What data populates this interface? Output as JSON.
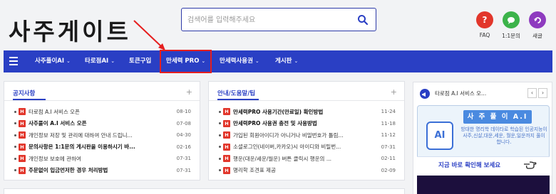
{
  "logo": "사주게이트",
  "search": {
    "placeholder": "검색어를 입력해주세요"
  },
  "quick": [
    {
      "label": "FAQ",
      "glyph": "?",
      "color": "#e2362b"
    },
    {
      "label": "1:1문의",
      "glyph": "●",
      "color": "#3cb34a"
    },
    {
      "label": "새글",
      "glyph": "ᄋ",
      "color": "#8e3bbf"
    }
  ],
  "nav": {
    "items": [
      {
        "label": "사주풀이AI",
        "chevron": "⌄"
      },
      {
        "label": "타로점AI",
        "chevron": "⌄"
      },
      {
        "label": "토큰구입",
        "chevron": ""
      },
      {
        "label": "만세력 PRO",
        "chevron": "⌄"
      },
      {
        "label": "만세력사용권",
        "chevron": "⌄"
      },
      {
        "label": "게시판",
        "chevron": "⌄"
      }
    ]
  },
  "notice": {
    "title": "공지사항",
    "plus": "+",
    "rows": [
      {
        "badge": "H",
        "text": "타로점 A.I 서비스 오픈",
        "date": "08-10",
        "bold": false
      },
      {
        "badge": "H",
        "text": "사주풀이 A.I 서비스 오픈",
        "date": "07-08",
        "bold": true
      },
      {
        "badge": "H",
        "text": "개인정보 저장 및 관리에 대하여 안내 드립니...",
        "date": "04-30",
        "bold": false
      },
      {
        "badge": "H",
        "text": "문의사항은 1:1문의 게시판을 이용하시기 바...",
        "date": "02-16",
        "bold": true
      },
      {
        "badge": "H",
        "text": "개인정보 보호에 관하여",
        "date": "07-31",
        "bold": false
      },
      {
        "badge": "H",
        "text": "주문없이 입금먼저한 경우 처리방법",
        "date": "07-31",
        "bold": true
      }
    ]
  },
  "guide": {
    "title": "안내/도움말/팁",
    "plus": "+",
    "rows": [
      {
        "badge": "H",
        "text": "만세력PRO 사용기간(만료일) 확인방법",
        "date": "11-24",
        "bold": true
      },
      {
        "badge": "H",
        "text": "만세력PRO 사용권 충전 및 사용방법",
        "date": "11-18",
        "bold": true
      },
      {
        "badge": "H",
        "text": "가입된 회원아이디가 아니거나 비밀번호가 틀림...",
        "date": "11-12",
        "bold": false
      },
      {
        "badge": "H",
        "text": "소셜로그인(네이버,카카오)시 아이디와 비밀번...",
        "date": "07-31",
        "bold": false
      },
      {
        "badge": "H",
        "text": "행운(대운/세운/월운) 버튼 클릭시 행운의 ...",
        "date": "02-11",
        "bold": false
      },
      {
        "badge": "H",
        "text": "명리학 조견표 제공",
        "date": "02-09",
        "bold": false
      }
    ]
  },
  "widget": {
    "head": "타로점 A.I 서비스 오...",
    "prev": "‹",
    "next": "›",
    "banner_title": "사 주 풀 이 A.I",
    "banner_ai": "AI",
    "banner_desc": "방대한 명리학 데이타로 학습된 인공지능이 사주,신살,대운,세운, 월운,일운까지 풀이 합니다.",
    "cta": "지금 바로 확인해 보세요"
  }
}
